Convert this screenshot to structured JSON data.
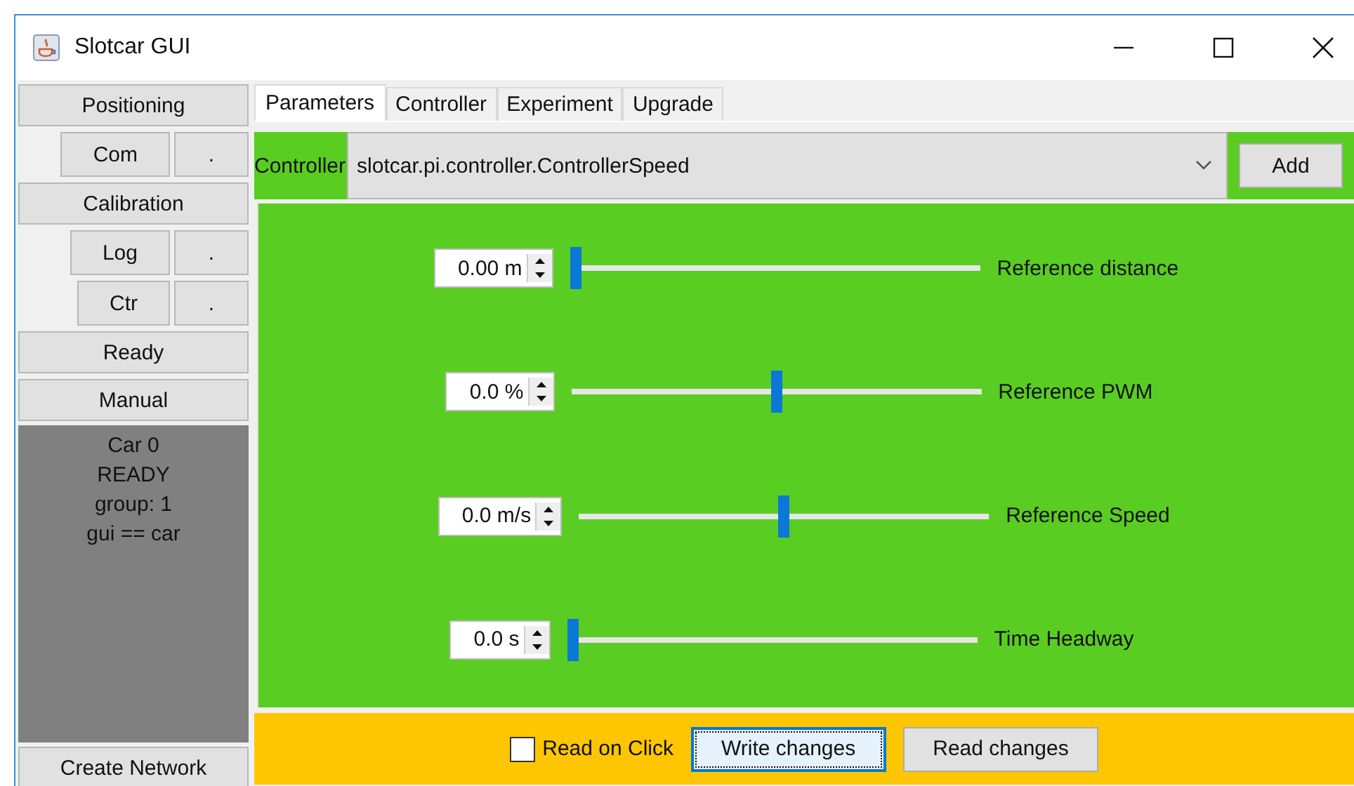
{
  "window": {
    "title": "Slotcar GUI"
  },
  "sidebar": {
    "items": [
      {
        "kind": "wide",
        "label": "Positioning"
      },
      {
        "kind": "pair",
        "label": "Com",
        "extra": "."
      },
      {
        "kind": "wide",
        "label": "Calibration"
      },
      {
        "kind": "pair",
        "label": "Log",
        "extra": "."
      },
      {
        "kind": "pair",
        "label": "Ctr",
        "extra": "."
      },
      {
        "kind": "wide",
        "label": "Ready"
      },
      {
        "kind": "wide",
        "label": "Manual"
      }
    ],
    "status_lines": [
      "Car 0",
      "READY",
      "group: 1",
      "gui == car"
    ],
    "bottom_button": "Create Network"
  },
  "tabs": [
    {
      "label": "Parameters",
      "selected": true
    },
    {
      "label": "Controller",
      "selected": false
    },
    {
      "label": "Experiment",
      "selected": false
    },
    {
      "label": "Upgrade",
      "selected": false
    }
  ],
  "controller": {
    "label": "Controller",
    "value": "slotcar.pi.controller.ControllerSpeed",
    "add_button": "Add"
  },
  "parameters": [
    {
      "value": "0.00 m",
      "level": 0.0,
      "label": "Reference distance"
    },
    {
      "value": "0.0 %",
      "level": 0.5,
      "label": "Reference PWM"
    },
    {
      "value": "0.0 m/s",
      "level": 0.5,
      "label": "Reference Speed"
    },
    {
      "value": "0.0 s",
      "level": 0.0,
      "label": "Time Headway"
    }
  ],
  "footer": {
    "checkbox": {
      "label": "Read on Click",
      "checked": false
    },
    "buttons": [
      {
        "label": "Write changes",
        "focused": true
      },
      {
        "label": "Read changes",
        "focused": false
      }
    ]
  }
}
